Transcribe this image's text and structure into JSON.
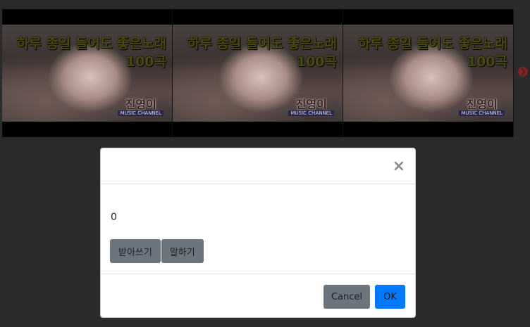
{
  "carousel": {
    "items": [
      {
        "title_line1": "하루 종일 들어도 좋은노래",
        "title_line2": "100곡",
        "brand": "진영이",
        "brand_sub": "MUSIC CHANNEL"
      },
      {
        "title_line1": "하루 종일 들어도 좋은노래",
        "title_line2": "100곡",
        "brand": "진영이",
        "brand_sub": "MUSIC CHANNEL"
      },
      {
        "title_line1": "하루 종일 들어도 좋은노래",
        "title_line2": "100곡",
        "brand": "진영이",
        "brand_sub": "MUSIC CHANNEL"
      }
    ],
    "next_glyph": "❯"
  },
  "modal": {
    "close_glyph": "×",
    "count_text": "0",
    "dictation_label": "받아쓰기",
    "speak_label": "말하기",
    "cancel_label": "Cancel",
    "ok_label": "OK"
  },
  "colors": {
    "backdrop": "#2a2a2a",
    "ok_button": "#007bff",
    "secondary_button": "#6c757d"
  }
}
